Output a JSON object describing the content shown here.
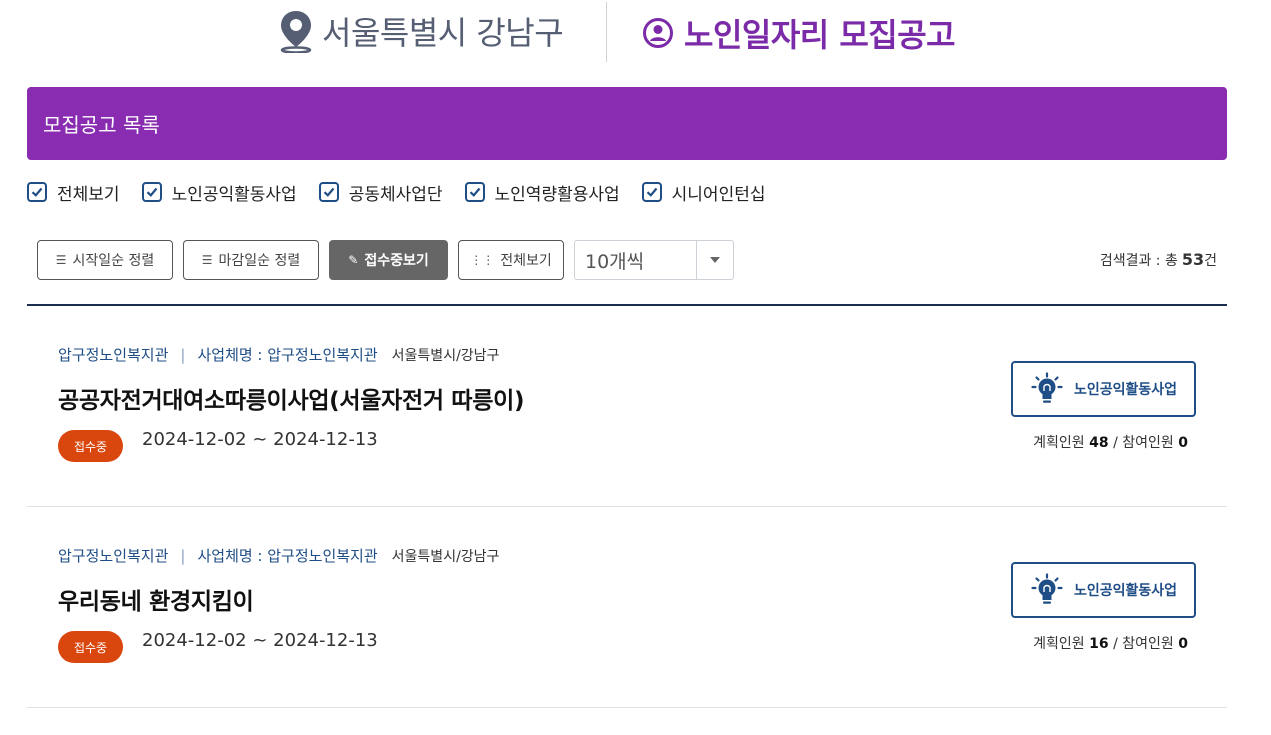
{
  "header": {
    "region": "서울특별시 강남구",
    "title": "노인일자리 모집공고"
  },
  "banner": {
    "title": "모집공고 목록"
  },
  "filters": [
    {
      "label": "전체보기",
      "checked": true
    },
    {
      "label": "노인공익활동사업",
      "checked": true
    },
    {
      "label": "공동체사업단",
      "checked": true
    },
    {
      "label": "노인역량활용사업",
      "checked": true
    },
    {
      "label": "시니어인턴십",
      "checked": true
    }
  ],
  "toolbar": {
    "sort_start": "시작일순 정렬",
    "sort_end": "마감일순 정렬",
    "view_open": "접수중보기",
    "view_all": "전체보기",
    "page_size": "10개씩"
  },
  "result": {
    "label": "검색결과 : 총",
    "count": "53",
    "unit": "건"
  },
  "items": [
    {
      "org": "압구정노인복지관",
      "sep": "|",
      "biz": "사업체명 : 압구정노인복지관",
      "location": "서울특별시/강남구",
      "title": "공공자전거대여소따릉이사업(서울자전거 따릉이)",
      "status": "접수중",
      "dates": "2024-12-02 ~ 2024-12-13",
      "type": "노인공익활동사업",
      "planned_label": "계획인원",
      "planned": "48",
      "slash": "/",
      "joined_label": "참여인원",
      "joined": "0"
    },
    {
      "org": "압구정노인복지관",
      "sep": "|",
      "biz": "사업체명 : 압구정노인복지관",
      "location": "서울특별시/강남구",
      "title": "우리동네 환경지킴이",
      "status": "접수중",
      "dates": "2024-12-02 ~ 2024-12-13",
      "type": "노인공익활동사업",
      "planned_label": "계획인원",
      "planned": "16",
      "slash": "/",
      "joined_label": "참여인원",
      "joined": "0"
    }
  ],
  "colors": {
    "brand_purple": "#892cb2",
    "title_purple": "#7b2aa8",
    "navy": "#1f4d86",
    "status_orange": "#d9470f"
  }
}
